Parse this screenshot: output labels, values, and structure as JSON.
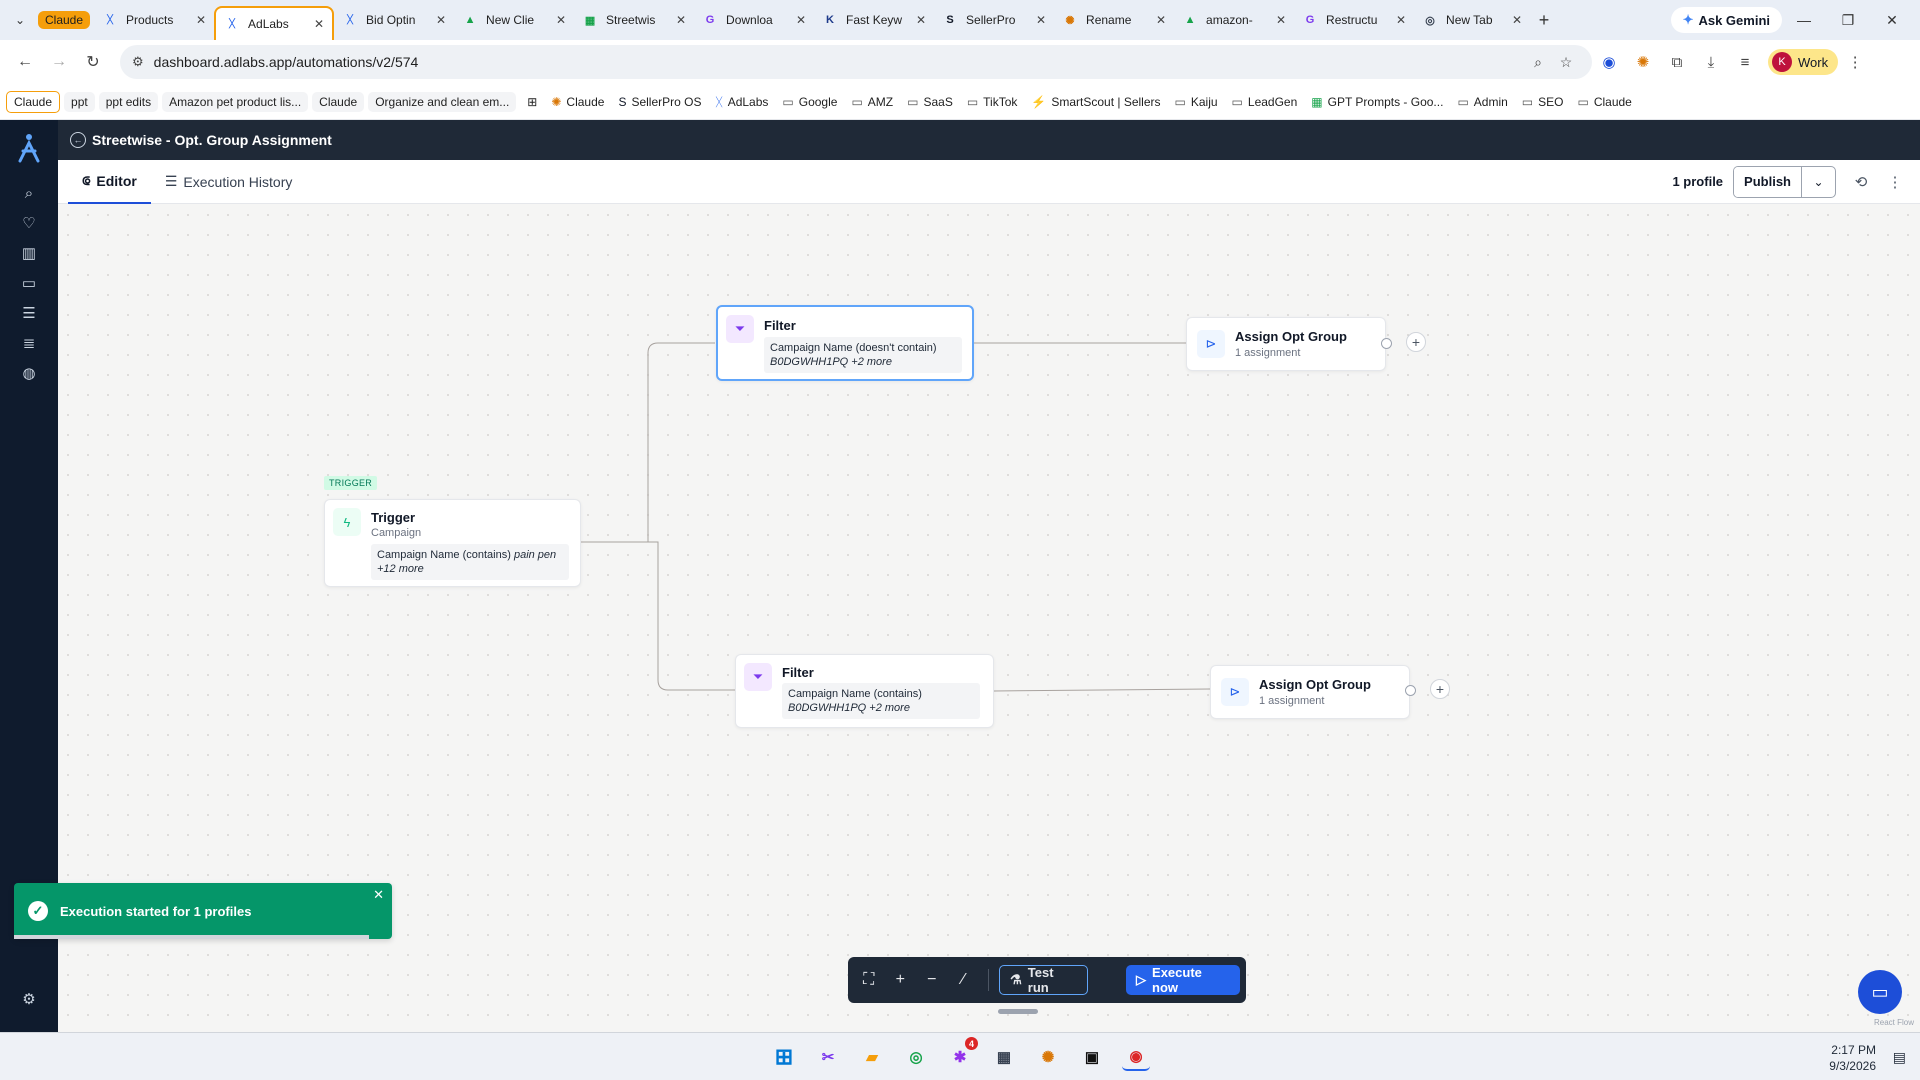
{
  "browser": {
    "tab_group_label": "Claude",
    "tabs": [
      {
        "label": "Products",
        "favicon": "adlabs-icon",
        "active": false
      },
      {
        "label": "AdLabs",
        "favicon": "adlabs-icon",
        "active": true
      },
      {
        "label": "Bid Optin",
        "favicon": "adlabs-icon",
        "active": false
      },
      {
        "label": "New Clie",
        "favicon": "drive-icon",
        "active": false
      },
      {
        "label": "Streetwis",
        "favicon": "sheets-icon",
        "active": false
      },
      {
        "label": "Downloa",
        "favicon": "g-icon",
        "active": false
      },
      {
        "label": "Fast Keyw",
        "favicon": "k-icon",
        "active": false
      },
      {
        "label": "SellerPro",
        "favicon": "sp-icon",
        "active": false
      },
      {
        "label": "Rename",
        "favicon": "claude-icon",
        "active": false
      },
      {
        "label": "amazon-",
        "favicon": "drive-icon",
        "active": false
      },
      {
        "label": "Restructu",
        "favicon": "g-icon",
        "active": false
      },
      {
        "label": "New Tab",
        "favicon": "chrome-icon",
        "active": false
      }
    ],
    "ask_gemini": "Ask Gemini",
    "url": "dashboard.adlabs.app/automations/v2/574",
    "profile_initial": "K",
    "profile_label": "Work",
    "bookmarks": [
      {
        "label": "Claude",
        "style": "outline"
      },
      {
        "label": "ppt",
        "style": "pill"
      },
      {
        "label": "ppt edits",
        "style": "pill"
      },
      {
        "label": "Amazon pet product lis...",
        "style": "pill"
      },
      {
        "label": "Claude",
        "style": "pill"
      },
      {
        "label": "Organize and clean em...",
        "style": "pill"
      },
      {
        "label": "Claude",
        "icon": "claude-icon"
      },
      {
        "label": "SellerPro OS",
        "icon": "sp-icon"
      },
      {
        "label": "AdLabs",
        "icon": "adlabs-icon"
      },
      {
        "label": "Google",
        "icon": "folder-icon"
      },
      {
        "label": "AMZ",
        "icon": "folder-icon"
      },
      {
        "label": "SaaS",
        "icon": "folder-icon"
      },
      {
        "label": "TikTok",
        "icon": "folder-icon"
      },
      {
        "label": "SmartScout | Sellers",
        "icon": "smartscout-icon"
      },
      {
        "label": "Kaiju",
        "icon": "folder-icon"
      },
      {
        "label": "LeadGen",
        "icon": "folder-icon"
      },
      {
        "label": "GPT Prompts - Goo...",
        "icon": "sheets-icon"
      },
      {
        "label": "Admin",
        "icon": "folder-icon"
      },
      {
        "label": "SEO",
        "icon": "folder-icon"
      },
      {
        "label": "Claude",
        "icon": "folder-icon"
      }
    ]
  },
  "app": {
    "title": "Streetwise - Opt. Group Assignment",
    "tabs": {
      "editor": "Editor",
      "history": "Execution History"
    },
    "profiles": "1 profile",
    "publish": "Publish"
  },
  "flow": {
    "trigger": {
      "tag": "TRIGGER",
      "title": "Trigger",
      "subtitle": "Campaign",
      "condition": "Campaign Name (contains)",
      "value": "pain pen",
      "more": "+12 more"
    },
    "filter_top": {
      "title": "Filter",
      "condition": "Campaign Name (doesn't contain)",
      "value": "B0DGWHH1PQ +2 more"
    },
    "filter_bottom": {
      "title": "Filter",
      "condition": "Campaign Name (contains)",
      "value": "B0DGWHH1PQ +2 more"
    },
    "assign_top": {
      "title": "Assign Opt Group",
      "subtitle": "1 assignment"
    },
    "assign_bottom": {
      "title": "Assign Opt Group",
      "subtitle": "1 assignment"
    }
  },
  "controls": {
    "test_run": "Test run",
    "execute_now": "Execute now"
  },
  "toast": {
    "message": "Execution started for 1 profiles",
    "progress": 0.94
  },
  "attribution": "React Flow",
  "taskbar": {
    "time": "2:17 PM",
    "date": "9/3/2026",
    "slack_badge": "4"
  },
  "colors": {
    "accent": "#2563eb",
    "success": "#059669",
    "sidebar": "#0f1b2d",
    "tab_group": "#f59e0b"
  }
}
